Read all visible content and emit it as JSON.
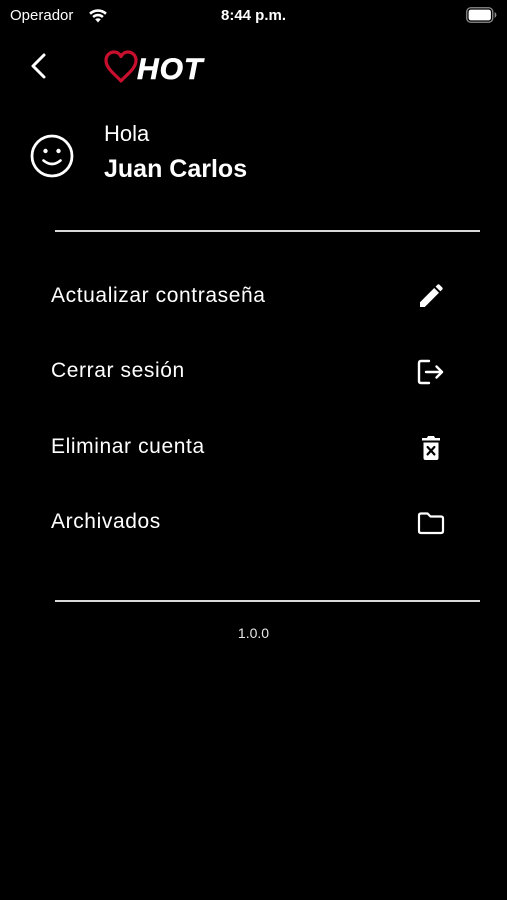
{
  "status_bar": {
    "carrier": "Operador",
    "time": "8:44 p.m."
  },
  "header": {
    "logo_text": "HOT"
  },
  "profile": {
    "greeting": "Hola",
    "name": "Juan Carlos"
  },
  "menu": {
    "items": [
      {
        "label": "Actualizar contraseña",
        "icon": "pencil-icon"
      },
      {
        "label": "Cerrar sesión",
        "icon": "logout-icon"
      },
      {
        "label": "Eliminar cuenta",
        "icon": "trash-icon"
      },
      {
        "label": "Archivados",
        "icon": "folder-icon"
      }
    ]
  },
  "footer": {
    "version": "1.0.0"
  },
  "colors": {
    "background": "#000000",
    "text": "#ffffff",
    "logo_heart": "#c8102e",
    "divider": "#d9d9d9"
  }
}
